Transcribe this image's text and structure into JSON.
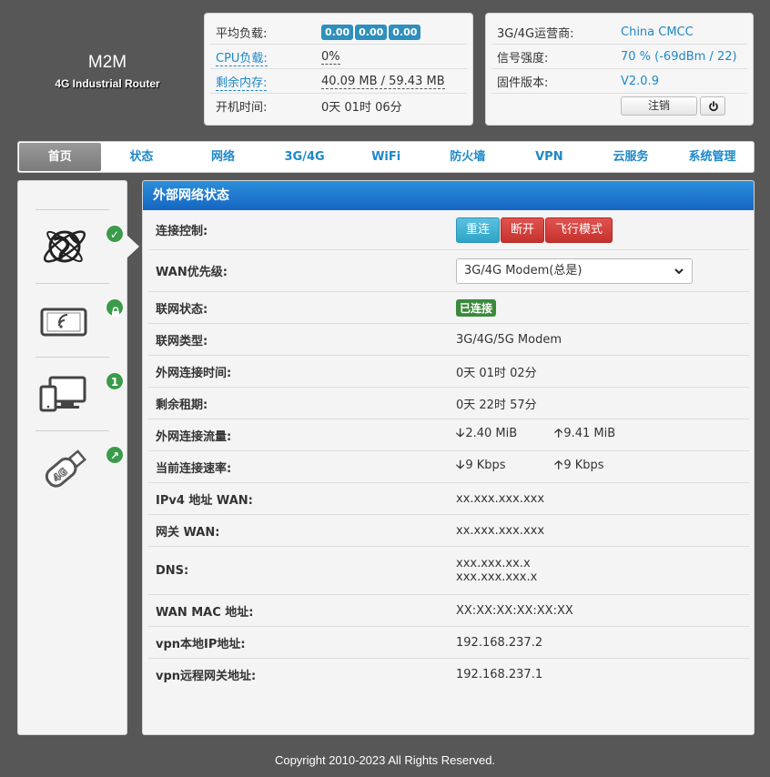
{
  "logo": {
    "name": "M2M",
    "subtitle": "4G Industrial Router"
  },
  "status_left": {
    "load_label": "平均负载:",
    "load_values": [
      "0.00",
      "0.00",
      "0.00"
    ],
    "cpu_label": "CPU负载:",
    "cpu_value": "0%",
    "mem_label": "剩余内存:",
    "mem_value": "40.09 MB / 59.43 MB",
    "uptime_label": "开机时间:",
    "uptime_value": "0天 01时 06分"
  },
  "status_right": {
    "carrier_label": "3G/4G运营商:",
    "carrier_value": "China CMCC",
    "signal_label": "信号强度:",
    "signal_value": "70 % (-69dBm / 22)",
    "firmware_label": "固件版本:",
    "firmware_value": "V2.0.9",
    "logout_label": "注销"
  },
  "nav": [
    "首页",
    "状态",
    "网络",
    "3G/4G",
    "WiFi",
    "防火墙",
    "VPN",
    "云服务",
    "系统管理"
  ],
  "sidebar_badges": {
    "tablet": "",
    "devices": "1"
  },
  "main": {
    "title": "外部网络状态",
    "connect_label": "连接控制:",
    "btn_reconnect": "重连",
    "btn_disconnect": "断开",
    "btn_airplane": "飞行模式",
    "wan_priority_label": "WAN优先级:",
    "wan_priority_value": "3G/4G Modem(总是)",
    "net_status_label": "联网状态:",
    "net_status_value": "已连接",
    "net_type_label": "联网类型:",
    "net_type_value": "3G/4G/5G Modem",
    "conn_time_label": "外网连接时间:",
    "conn_time_value": "0天 01时 02分",
    "lease_label": "剩余租期:",
    "lease_value": "0天 22时 57分",
    "traffic_label": "外网连接流量:",
    "traffic_down": "2.40 MiB",
    "traffic_up": "9.41 MiB",
    "rate_label": "当前连接速率:",
    "rate_down": "9 Kbps",
    "rate_up": "9 Kbps",
    "ipv4_label": "IPv4 地址 WAN:",
    "ipv4_value": "xx.xxx.xxx.xxx",
    "gateway_label": "网关 WAN:",
    "gateway_value": "xx.xxx.xxx.xxx",
    "dns_label": "DNS:",
    "dns_value_1": "xxx.xxx.xx.x",
    "dns_value_2": "xxx.xxx.xxx.x",
    "mac_label": "WAN MAC 地址:",
    "mac_value": "XX:XX:XX:XX:XX:XX",
    "vpn_local_label": "vpn本地IP地址:",
    "vpn_local_value": "192.168.237.2",
    "vpn_remote_label": "vpn远程网关地址:",
    "vpn_remote_value": "192.168.237.1"
  },
  "footer": "Copyright 2010-2023 All Rights Reserved."
}
